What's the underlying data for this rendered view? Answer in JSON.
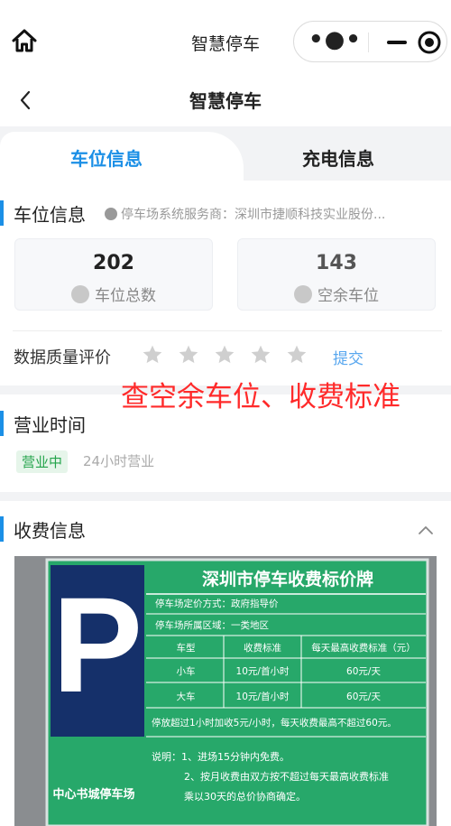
{
  "app": {
    "title": "智慧停车",
    "more_glyph": "•●•"
  },
  "nav": {
    "title": "智慧停车"
  },
  "tabs": [
    {
      "label": "车位信息",
      "active": true
    },
    {
      "label": "充电信息",
      "active": false
    }
  ],
  "parking": {
    "section_title": "车位信息",
    "provider_text": "停车场系统服务商：深圳市捷顺科技实业股份...",
    "total": {
      "value": "202",
      "label": "车位总数"
    },
    "free": {
      "value": "143",
      "label": "空余车位"
    }
  },
  "rating": {
    "label": "数据质量评价",
    "stars": 5,
    "filled": 0,
    "submit_label": "提交"
  },
  "overlay_text": "查空余车位、收费标准",
  "hours": {
    "section_title": "营业时间",
    "status_badge": "营业中",
    "hours_text": "24小时营业"
  },
  "fees": {
    "section_title": "收费信息"
  },
  "sign": {
    "title": "深圳市停车收费标价牌",
    "p_letter": "P",
    "lot_name": "中心书城停车场",
    "pricing_method": "停车场定价方式：政府指导价",
    "area": "停车场所属区域：一类地区",
    "headers": [
      "车型",
      "收费标准",
      "每天最高收费标准（元）"
    ],
    "rows": [
      [
        "小车",
        "10元/首小时",
        "60元/天"
      ],
      [
        "大车",
        "10元/首小时",
        "60元/天"
      ]
    ],
    "extra_note": "停放超过1小时加收5元/小时，每天收费最高不超过60元。",
    "notes": [
      "说明：1、进场15分钟内免费。",
      "2、按月收费由双方按不超过每天最高收费标准",
      "乘以30天的总价协商确定。"
    ]
  },
  "colors": {
    "accent": "#1b8fe6",
    "overlay": "#ff2a2a",
    "open_green": "#22a34a",
    "sign_green": "#27a86a",
    "sign_navy": "#15306a"
  }
}
